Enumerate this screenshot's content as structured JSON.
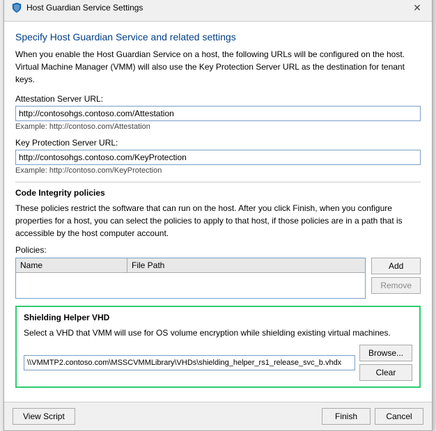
{
  "window": {
    "title": "Host Guardian Service Settings",
    "close_label": "✕"
  },
  "dialog": {
    "heading": "Specify Host Guardian Service and related settings",
    "description": "When you enable the Host Guardian Service on a host, the following URLs will be configured on the host. Virtual Machine Manager (VMM) will also use the Key Protection Server URL as the destination for tenant keys."
  },
  "attestation": {
    "label": "Attestation Server URL:",
    "value": "http://contosohgs.contoso.com/Attestation",
    "example": "Example: http://contoso.com/Attestation"
  },
  "key_protection": {
    "label": "Key Protection Server URL:",
    "value": "http://contosohgs.contoso.com/KeyProtection",
    "example": "Example: http://contoso.com/KeyProtection"
  },
  "code_integrity": {
    "title": "Code Integrity policies",
    "description": "These policies restrict the software that can run on the host. After you click Finish, when you configure properties for a host, you can select the policies to apply to that host, if those policies are in a path that is accessible by the host computer account.",
    "policies_label": "Policies:",
    "table": {
      "col_name": "Name",
      "col_path": "File Path"
    },
    "add_button": "Add",
    "remove_button": "Remove"
  },
  "shielding": {
    "title": "Shielding Helper VHD",
    "description": "Select a VHD that VMM will use for OS volume encryption while shielding existing virtual machines.",
    "value": "\\\\VMMTP2.contoso.com\\MSSCVMMLibrary\\VHDs\\shielding_helper_rs1_release_svc_b.vhdx",
    "browse_button": "Browse...",
    "clear_button": "Clear"
  },
  "footer": {
    "view_script": "View Script",
    "finish": "Finish",
    "cancel": "Cancel"
  }
}
